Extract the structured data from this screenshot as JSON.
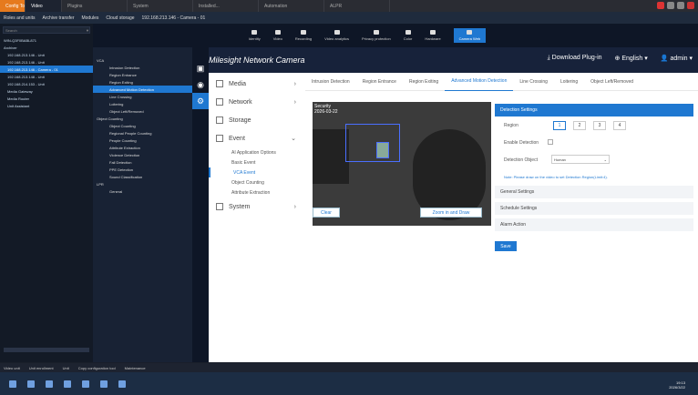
{
  "browser": {
    "tabs": [
      "Config Tool",
      "Video",
      "Plugins",
      "System",
      "Installed...",
      "Automation",
      "ALPR"
    ]
  },
  "nav": {
    "items": [
      "Roles and units",
      "Archive transfer",
      "Modules",
      "Cloud storage",
      "192.168.213.146 - Camera - 01"
    ]
  },
  "appbar": {
    "items": [
      "Identity",
      "Video",
      "Recording",
      "Video analytics",
      "Privacy protection",
      "Color",
      "Hardware",
      "Camera Web"
    ]
  },
  "tree": {
    "search": "Search",
    "items": [
      {
        "label": "WIN-Q3F0BABL871",
        "sel": false
      },
      {
        "label": "Archiver",
        "sel": false
      },
      {
        "label": "192.168.213.146 - Unit",
        "sel": false
      },
      {
        "label": "192.168.213.146 - Unit",
        "sel": false
      },
      {
        "label": "192.168.213.146 - Camera - 01",
        "sel": true
      },
      {
        "label": "192.168.213.148 - Unit",
        "sel": false
      },
      {
        "label": "192.168.214.153 - Unit",
        "sel": false
      },
      {
        "label": "Media Gateway",
        "sel": false
      },
      {
        "label": "Media Router",
        "sel": false
      },
      {
        "label": "Unit Assistant",
        "sel": false
      }
    ]
  },
  "vca": {
    "items": [
      {
        "label": "VCA",
        "sel": false
      },
      {
        "label": "Intrusion Detection",
        "sel": false
      },
      {
        "label": "Region Entrance",
        "sel": false
      },
      {
        "label": "Region Exiting",
        "sel": false
      },
      {
        "label": "Advanced Motion Detection",
        "sel": true
      },
      {
        "label": "Line Crossing",
        "sel": false
      },
      {
        "label": "Loitering",
        "sel": false
      },
      {
        "label": "Object Left/Removed",
        "sel": false
      },
      {
        "label": "Object Counting",
        "sel": false
      },
      {
        "label": "Object Counting",
        "sel": false
      },
      {
        "label": "Regional People Counting",
        "sel": false
      },
      {
        "label": "People Counting",
        "sel": false
      },
      {
        "label": "Attribute Extraction",
        "sel": false
      },
      {
        "label": "Violence Detection",
        "sel": false
      },
      {
        "label": "Fall Detection",
        "sel": false
      },
      {
        "label": "PPE Detection",
        "sel": false
      },
      {
        "label": "Sound Classification",
        "sel": false
      },
      {
        "label": "LPR",
        "sel": false
      },
      {
        "label": "General",
        "sel": false
      }
    ]
  },
  "header": {
    "logo": "Milesight Network Camera",
    "download": "Download Plug-in",
    "language": "English",
    "user": "admin"
  },
  "side": {
    "media": "Media",
    "network": "Network",
    "storage": "Storage",
    "event": "Event",
    "system": "System",
    "event_sub": [
      "AI Application Options",
      "Basic Event",
      "VCA Event",
      "Object Counting",
      "Attribute Extraction"
    ]
  },
  "tabs": [
    "Intrusion Detection",
    "Region Entrance",
    "Region Exiting",
    "Advanced Motion Detection",
    "Line Crossing",
    "Loitering",
    "Object Left/Removed"
  ],
  "video": {
    "osd": "Security",
    "osd2": "2026-03-22",
    "clear": "Clear",
    "zoom": "Zoom in and Draw"
  },
  "detection": {
    "title": "Detection Settings",
    "region_label": "Region",
    "regions": [
      "1",
      "2",
      "3",
      "4"
    ],
    "enable_label": "Enable Detection",
    "object_label": "Detection Object",
    "object_value": "Human",
    "note": "Note: Please draw on the video to set Detection Region(Limit:4).",
    "general": "General Settings",
    "schedule": "Schedule Settings",
    "alarm": "Alarm Action",
    "save": "Save"
  },
  "bottombar": [
    "Video unit",
    "Unit enrollment",
    "Unit",
    "Copy configuration tool",
    "Maintenance"
  ],
  "clock": {
    "time": "19:13",
    "date": "2026/3/22"
  }
}
